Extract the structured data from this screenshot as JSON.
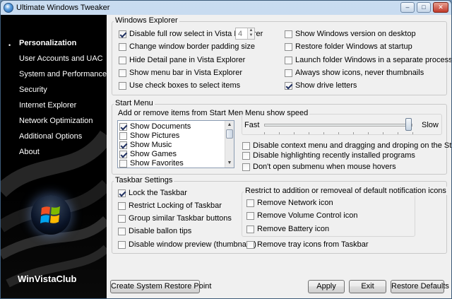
{
  "window": {
    "title": "Ultimate Windows Tweaker"
  },
  "caption_buttons": {
    "minimize": "–",
    "maximize": "□",
    "close": "✕"
  },
  "sidebar": {
    "bullet": "•",
    "items": [
      {
        "label": "Personalization",
        "active": true
      },
      {
        "label": "User Accounts and UAC"
      },
      {
        "label": "System and Performance"
      },
      {
        "label": "Security"
      },
      {
        "label": "Internet Explorer"
      },
      {
        "label": "Network Optimization"
      },
      {
        "label": "Additional Options"
      },
      {
        "label": "About"
      }
    ],
    "brand": "WinVistaClub"
  },
  "windows_explorer": {
    "title": "Windows Explorer",
    "left": [
      {
        "label": "Disable full row select in Vista Explorer",
        "checked": true
      },
      {
        "label": "Change window border padding size",
        "checked": false
      },
      {
        "label": "Hide Detail pane in Vista Explorer",
        "checked": false
      },
      {
        "label": "Show menu bar in Vista Explorer",
        "checked": false
      },
      {
        "label": "Use check boxes to select items",
        "checked": false
      }
    ],
    "padding_value": "4",
    "right": [
      {
        "label": "Show Windows version on desktop",
        "checked": false
      },
      {
        "label": "Restore folder Windows at startup",
        "checked": false
      },
      {
        "label": "Launch folder Windows in a separate process",
        "checked": false
      },
      {
        "label": "Always show icons, never thumbnails",
        "checked": false
      },
      {
        "label": "Show drive letters",
        "checked": true
      }
    ]
  },
  "start_menu": {
    "title": "Start Menu",
    "add_remove_label": "Add or remove items from Start Menu",
    "items": [
      {
        "label": "Show Documents",
        "checked": true
      },
      {
        "label": "Show Pictures",
        "checked": false
      },
      {
        "label": "Show Music",
        "checked": true
      },
      {
        "label": "Show Games",
        "checked": true
      },
      {
        "label": "Show Favorites",
        "checked": false
      }
    ],
    "speed": {
      "title": "Menu show speed",
      "fast_label": "Fast",
      "slow_label": "Slow",
      "level": 0.97
    },
    "options": [
      {
        "label": "Disable context menu and dragging and droping on the Start Menu",
        "checked": false
      },
      {
        "label": "Disable highlighting recently installed programs",
        "checked": false
      },
      {
        "label": "Don't open submenu when mouse hovers",
        "checked": false
      }
    ]
  },
  "taskbar": {
    "title": "Taskbar Settings",
    "left": [
      {
        "label": "Lock the Taskbar",
        "checked": true
      },
      {
        "label": "Restrict Locking of Taskbar",
        "checked": false
      },
      {
        "label": "Group similar Taskbar buttons",
        "checked": false
      },
      {
        "label": "Disable ballon tips",
        "checked": false
      },
      {
        "label": "Disable window preview (thumbnails)",
        "checked": false
      }
    ],
    "notify_title": "Restrict to addition or removeal of default notification icons",
    "notify": [
      {
        "label": "Remove Network icon",
        "checked": false
      },
      {
        "label": "Remove Volume Control icon",
        "checked": false
      },
      {
        "label": "Remove Battery icon",
        "checked": false
      }
    ],
    "tray": {
      "label": "Remove tray icons from Taskbar",
      "checked": false
    }
  },
  "buttons": {
    "restore_point": "Create System Restore Point",
    "apply": "Apply",
    "exit": "Exit",
    "restore_defaults": "Restore Defaults"
  }
}
